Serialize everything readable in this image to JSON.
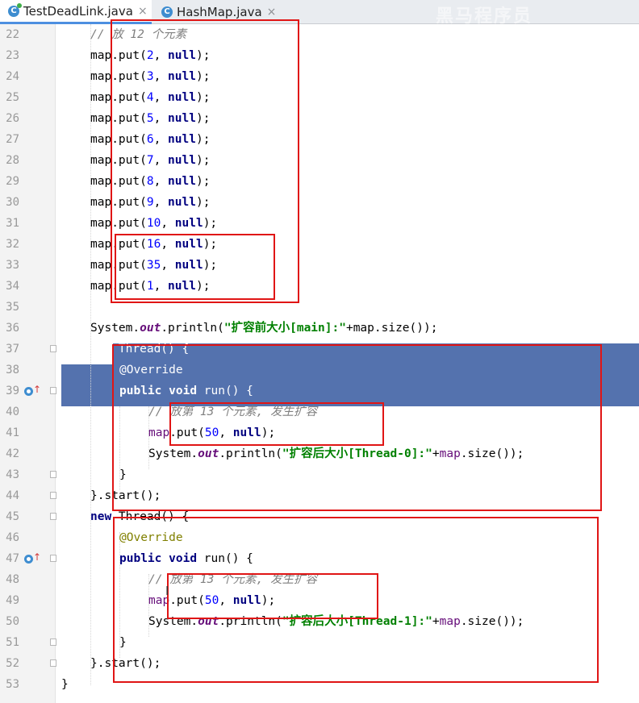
{
  "tabs": [
    {
      "label": "TestDeadLink.java",
      "icon": "java-class-icon",
      "close": "×",
      "active": true
    },
    {
      "label": "HashMap.java",
      "icon": "java-class-icon",
      "close": "×",
      "active": false
    }
  ],
  "watermark": "黑马程序员",
  "colors": {
    "selection": "#5472ae",
    "keyword": "#000080",
    "number": "#0000ff",
    "comment": "#808080",
    "string": "#008000",
    "annotation": "#808000",
    "highlight_box": "#e01515"
  },
  "lines": [
    {
      "n": "22",
      "indent": 2,
      "tokens": [
        {
          "t": "// 放 12 个元素",
          "c": "cm"
        }
      ]
    },
    {
      "n": "23",
      "indent": 2,
      "tokens": [
        {
          "t": "map.put("
        },
        {
          "t": "2",
          "c": "num"
        },
        {
          "t": ", "
        },
        {
          "t": "null",
          "c": "kw"
        },
        {
          "t": ");"
        }
      ]
    },
    {
      "n": "24",
      "indent": 2,
      "tokens": [
        {
          "t": "map.put("
        },
        {
          "t": "3",
          "c": "num"
        },
        {
          "t": ", "
        },
        {
          "t": "null",
          "c": "kw"
        },
        {
          "t": ");"
        }
      ]
    },
    {
      "n": "25",
      "indent": 2,
      "tokens": [
        {
          "t": "map.put("
        },
        {
          "t": "4",
          "c": "num"
        },
        {
          "t": ", "
        },
        {
          "t": "null",
          "c": "kw"
        },
        {
          "t": ");"
        }
      ]
    },
    {
      "n": "26",
      "indent": 2,
      "tokens": [
        {
          "t": "map.put("
        },
        {
          "t": "5",
          "c": "num"
        },
        {
          "t": ", "
        },
        {
          "t": "null",
          "c": "kw"
        },
        {
          "t": ");"
        }
      ]
    },
    {
      "n": "27",
      "indent": 2,
      "tokens": [
        {
          "t": "map.put("
        },
        {
          "t": "6",
          "c": "num"
        },
        {
          "t": ", "
        },
        {
          "t": "null",
          "c": "kw"
        },
        {
          "t": ");"
        }
      ]
    },
    {
      "n": "28",
      "indent": 2,
      "tokens": [
        {
          "t": "map.put("
        },
        {
          "t": "7",
          "c": "num"
        },
        {
          "t": ", "
        },
        {
          "t": "null",
          "c": "kw"
        },
        {
          "t": ");"
        }
      ]
    },
    {
      "n": "29",
      "indent": 2,
      "tokens": [
        {
          "t": "map.put("
        },
        {
          "t": "8",
          "c": "num"
        },
        {
          "t": ", "
        },
        {
          "t": "null",
          "c": "kw"
        },
        {
          "t": ");"
        }
      ]
    },
    {
      "n": "30",
      "indent": 2,
      "tokens": [
        {
          "t": "map.put("
        },
        {
          "t": "9",
          "c": "num"
        },
        {
          "t": ", "
        },
        {
          "t": "null",
          "c": "kw"
        },
        {
          "t": ");"
        }
      ]
    },
    {
      "n": "31",
      "indent": 2,
      "tokens": [
        {
          "t": "map.put("
        },
        {
          "t": "10",
          "c": "num"
        },
        {
          "t": ", "
        },
        {
          "t": "null",
          "c": "kw"
        },
        {
          "t": ");"
        }
      ]
    },
    {
      "n": "32",
      "indent": 2,
      "tokens": [
        {
          "t": "map.put("
        },
        {
          "t": "16",
          "c": "num"
        },
        {
          "t": ", "
        },
        {
          "t": "null",
          "c": "kw"
        },
        {
          "t": ");"
        }
      ]
    },
    {
      "n": "33",
      "indent": 2,
      "tokens": [
        {
          "t": "map.put("
        },
        {
          "t": "35",
          "c": "num"
        },
        {
          "t": ", "
        },
        {
          "t": "null",
          "c": "kw"
        },
        {
          "t": ");"
        }
      ]
    },
    {
      "n": "34",
      "indent": 2,
      "tokens": [
        {
          "t": "map.put("
        },
        {
          "t": "1",
          "c": "num"
        },
        {
          "t": ", "
        },
        {
          "t": "null",
          "c": "kw"
        },
        {
          "t": ");"
        }
      ]
    },
    {
      "n": "35",
      "indent": 2,
      "tokens": []
    },
    {
      "n": "36",
      "indent": 2,
      "tokens": [
        {
          "t": "System."
        },
        {
          "t": "out",
          "c": "fld"
        },
        {
          "t": ".println("
        },
        {
          "t": "\"扩容前大小[main]:\"",
          "c": "str"
        },
        {
          "t": "+map.size());"
        }
      ]
    },
    {
      "n": "37",
      "indent": 2,
      "fold": true,
      "sel": true,
      "tokens": [
        {
          "t": "new",
          "c": "kw"
        },
        {
          "t": " Thread() {"
        }
      ]
    },
    {
      "n": "38",
      "indent": 3,
      "sel": true,
      "tokens": [
        {
          "t": "@Override",
          "c": "ann"
        }
      ]
    },
    {
      "n": "39",
      "indent": 3,
      "fold": true,
      "sel": true,
      "marker": true,
      "tokens": [
        {
          "t": "public",
          "c": "kw"
        },
        {
          "t": " "
        },
        {
          "t": "void",
          "c": "kw"
        },
        {
          "t": " run() {"
        }
      ]
    },
    {
      "n": "40",
      "indent": 4,
      "tokens": [
        {
          "t": "// 放第 13 个元素, 发生扩容",
          "c": "cm"
        }
      ]
    },
    {
      "n": "41",
      "indent": 4,
      "tokens": [
        {
          "t": "map",
          "c": "var"
        },
        {
          "t": ".put("
        },
        {
          "t": "50",
          "c": "num"
        },
        {
          "t": ", "
        },
        {
          "t": "null",
          "c": "kw"
        },
        {
          "t": ");"
        }
      ]
    },
    {
      "n": "42",
      "indent": 4,
      "tokens": [
        {
          "t": "System."
        },
        {
          "t": "out",
          "c": "fld"
        },
        {
          "t": ".println("
        },
        {
          "t": "\"扩容后大小[Thread-0]:\"",
          "c": "str"
        },
        {
          "t": "+"
        },
        {
          "t": "map",
          "c": "var"
        },
        {
          "t": ".size());"
        }
      ]
    },
    {
      "n": "43",
      "indent": 3,
      "fold": true,
      "tokens": [
        {
          "t": "}"
        }
      ]
    },
    {
      "n": "44",
      "indent": 2,
      "fold": true,
      "tokens": [
        {
          "t": "}.start();"
        }
      ]
    },
    {
      "n": "45",
      "indent": 2,
      "fold": true,
      "tokens": [
        {
          "t": "new",
          "c": "kw"
        },
        {
          "t": " Thread() {"
        }
      ]
    },
    {
      "n": "46",
      "indent": 3,
      "tokens": [
        {
          "t": "@Override",
          "c": "ann"
        }
      ]
    },
    {
      "n": "47",
      "indent": 3,
      "fold": true,
      "marker": true,
      "tokens": [
        {
          "t": "public",
          "c": "kw"
        },
        {
          "t": " "
        },
        {
          "t": "void",
          "c": "kw"
        },
        {
          "t": " run() {"
        }
      ]
    },
    {
      "n": "48",
      "indent": 4,
      "tokens": [
        {
          "t": "// 放第 13 个元素, 发生扩容",
          "c": "cm"
        }
      ]
    },
    {
      "n": "49",
      "indent": 4,
      "tokens": [
        {
          "t": "map",
          "c": "var"
        },
        {
          "t": ".put("
        },
        {
          "t": "50",
          "c": "num"
        },
        {
          "t": ", "
        },
        {
          "t": "null",
          "c": "kw"
        },
        {
          "t": ");"
        }
      ]
    },
    {
      "n": "50",
      "indent": 4,
      "tokens": [
        {
          "t": "System."
        },
        {
          "t": "out",
          "c": "fld"
        },
        {
          "t": ".println("
        },
        {
          "t": "\"扩容后大小[Thread-1]:\"",
          "c": "str"
        },
        {
          "t": "+"
        },
        {
          "t": "map",
          "c": "var"
        },
        {
          "t": ".size());"
        }
      ]
    },
    {
      "n": "51",
      "indent": 3,
      "fold": true,
      "tokens": [
        {
          "t": "}"
        }
      ]
    },
    {
      "n": "52",
      "indent": 2,
      "fold": true,
      "tokens": [
        {
          "t": "}.start();"
        }
      ]
    },
    {
      "n": "53",
      "indent": 1,
      "tokens": [
        {
          "t": "}"
        }
      ]
    }
  ]
}
